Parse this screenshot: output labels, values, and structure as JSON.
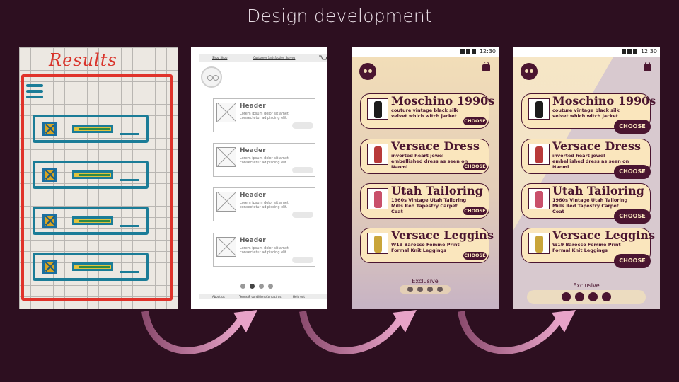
{
  "slide_title": "Design development",
  "sketch": {
    "title": "Results"
  },
  "wireframe": {
    "top_links": [
      "Shop Shop",
      "Customer Satisfaction Survey"
    ],
    "cards": [
      {
        "header": "Header",
        "body": "Lorem ipsum dolor sit amet, consectetur adipiscing elit."
      },
      {
        "header": "Header",
        "body": "Lorem ipsum dolor sit amet, consectetur adipiscing elit."
      },
      {
        "header": "Header",
        "body": "Lorem ipsum dolor sit amet, consectetur adipiscing elit."
      },
      {
        "header": "Header",
        "body": "Lorem ipsum dolor sit amet, consectetur adipiscing elit."
      }
    ],
    "footer_links": [
      "About us",
      "Terms & conditions",
      "Contact us",
      "Help out"
    ]
  },
  "mockup": {
    "status_time": "12:30",
    "items": [
      {
        "name": "Moschino 1990s",
        "desc": "couture vintage black silk velvet which witch jacket",
        "color": "#1c1c1c"
      },
      {
        "name": "Versace Dress",
        "desc": "inverted heart jewel embellished dress as seen on Naomi",
        "color": "#b83a3a"
      },
      {
        "name": "Utah Tailoring",
        "desc": "1960s Vintage Utah Tailoring Mills Red Tapestry Carpet Coat",
        "color": "#c9506a"
      },
      {
        "name": "Versace Leggins",
        "desc": "W19 Barocco Femme Print Formal Knit Leggings",
        "color": "#c9a53a"
      }
    ],
    "choose_label": "CHOOSE",
    "exclusive_label": "Exclusive"
  },
  "colors": {
    "background": "#2d0f20",
    "accent": "#4a1530",
    "arrow": "#d88fb4"
  }
}
